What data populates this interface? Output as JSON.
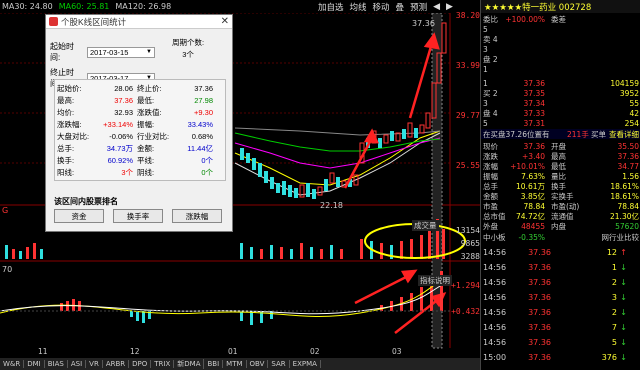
{
  "colors": {
    "up": "#ff3232",
    "down": "#2fe0e0",
    "accent": "#ffff00",
    "bg": "#000000"
  },
  "topbar": {
    "ma30": "MA30: 24.80",
    "ma60": "MA60: 25.81",
    "ma120": "MA120: 26.98",
    "tools": [
      "加自选",
      "均线",
      "移动",
      "叠",
      "预测"
    ]
  },
  "chart": {
    "price_labels": [
      "38.20",
      "33.99",
      "29.77",
      "25.55"
    ],
    "peak_label": "37.36",
    "low_label": "22.18",
    "volume_label": "成交量",
    "volume_ticks": [
      "13154",
      "9865",
      "3288"
    ],
    "macd_label": "指标说明",
    "macd_ticks": [
      "+1.294",
      "+0.432"
    ],
    "macd_prefix": "70",
    "date_ticks": [
      "11",
      "12",
      "01",
      "02",
      "03"
    ],
    "left_marker": "G"
  },
  "dialog": {
    "title": "个股K线区间统计",
    "start_label": "起始时间:",
    "start_value": "2017-03-15",
    "end_label": "终止时间:",
    "end_value": "2017-03-17",
    "period_label": "周期个数:",
    "period_value": "3个",
    "stats": [
      {
        "l1": "起始价:",
        "v1": "28.06",
        "c1": "",
        "l2": "终止价:",
        "v2": "37.36",
        "c2": ""
      },
      {
        "l1": "最高:",
        "v1": "37.36",
        "c1": "red",
        "l2": "最低:",
        "v2": "27.98",
        "c2": "grn"
      },
      {
        "l1": "均价:",
        "v1": "32.93",
        "c1": "",
        "l2": "涨跌值:",
        "v2": "+9.30",
        "c2": "red"
      },
      {
        "l1": "涨跌幅:",
        "v1": "+33.14%",
        "c1": "red",
        "l2": "振幅:",
        "v2": "33.43%",
        "c2": "blu"
      },
      {
        "l1": "大盘对比:",
        "v1": "-0.06%",
        "c1": "",
        "l2": "行业对比:",
        "v2": "0.68%",
        "c2": ""
      },
      {
        "l1": "总手:",
        "v1": "34.73万",
        "c1": "blu",
        "l2": "金额:",
        "v2": "11.44亿",
        "c2": "blu"
      },
      {
        "l1": "换手:",
        "v1": "60.92%",
        "c1": "blu",
        "l2": "平线:",
        "v2": "0个",
        "c2": "blu"
      },
      {
        "l1": "阳线:",
        "v1": "3个",
        "c1": "red",
        "l2": "阴线:",
        "v2": "0个",
        "c2": "grn"
      }
    ],
    "rank_title": "该区间内股票排名",
    "buttons": [
      "资金",
      "换手率",
      "涨跌幅"
    ]
  },
  "right": {
    "header": "★★★★★特一药业 002728",
    "rows": [
      {
        "a": "委比",
        "b": "+100.00%",
        "c": "委差",
        "d": "",
        "ac": "#ccc",
        "bc": "#f33",
        "cc": "#ccc",
        "dc": "#ff3"
      },
      {
        "a": "5",
        "b": "",
        "c": "",
        "d": "",
        "ac": "#ccc",
        "bc": "#ccc",
        "cc": "#ccc",
        "dc": "#ff3"
      },
      {
        "a": "卖 4",
        "b": "",
        "c": "",
        "d": "",
        "ac": "#ccc",
        "bc": "#ccc",
        "cc": "#ccc",
        "dc": "#ff3"
      },
      {
        "a": "3",
        "b": "",
        "c": "",
        "d": "",
        "ac": "#ccc",
        "bc": "#ccc",
        "cc": "#ccc",
        "dc": "#ff3"
      },
      {
        "a": "盘 2",
        "b": "",
        "c": "",
        "d": "",
        "ac": "#ccc",
        "bc": "#ccc",
        "cc": "#ccc",
        "dc": "#ff3"
      },
      {
        "a": "1",
        "b": "",
        "c": "",
        "d": "",
        "ac": "#ccc",
        "bc": "#ccc",
        "cc": "#ccc",
        "dc": "#ff3"
      },
      {
        "a": "1",
        "b": "37.36",
        "c": "",
        "d": "104159",
        "ac": "#ccc",
        "bc": "#f33",
        "cc": "#ccc",
        "dc": "#ff3"
      },
      {
        "a": "买 2",
        "b": "37.35",
        "c": "",
        "d": "3952",
        "ac": "#ccc",
        "bc": "#f33",
        "cc": "#ccc",
        "dc": "#ff3"
      },
      {
        "a": "3",
        "b": "37.34",
        "c": "",
        "d": "55",
        "ac": "#ccc",
        "bc": "#f33",
        "cc": "#ccc",
        "dc": "#ff3"
      },
      {
        "a": "盘 4",
        "b": "37.33",
        "c": "",
        "d": "42",
        "ac": "#ccc",
        "bc": "#f33",
        "cc": "#ccc",
        "dc": "#ff3"
      },
      {
        "a": "5",
        "b": "37.31",
        "c": "",
        "d": "254",
        "ac": "#ccc",
        "bc": "#f33",
        "cc": "#ccc",
        "dc": "#ff3"
      },
      {
        "a": "在买盘37.26位置有",
        "b": "211手",
        "c": "买单",
        "d": "查看详细",
        "ac": "#ccc",
        "bc": "#f33",
        "cc": "#ccc",
        "dc": "#ff3"
      },
      {
        "a": "现价",
        "b": "37.36",
        "c": "开盘",
        "d": "35.50",
        "ac": "#ccc",
        "bc": "#f33",
        "cc": "#ccc",
        "dc": "#f33"
      },
      {
        "a": "涨跌",
        "b": "+3.40",
        "c": "最高",
        "d": "37.36",
        "ac": "#ccc",
        "bc": "#f33",
        "cc": "#ccc",
        "dc": "#f33"
      },
      {
        "a": "涨幅",
        "b": "+10.01%",
        "c": "最低",
        "d": "34.77",
        "ac": "#ccc",
        "bc": "#f33",
        "cc": "#ccc",
        "dc": "#f33"
      },
      {
        "a": "振幅",
        "b": "7.63%",
        "c": "量比",
        "d": "1.56",
        "ac": "#ccc",
        "bc": "#ff3",
        "cc": "#ccc",
        "dc": "#ff3"
      },
      {
        "a": "总手",
        "b": "10.61万",
        "c": "换手",
        "d": "18.61%",
        "ac": "#ccc",
        "bc": "#ff3",
        "cc": "#ccc",
        "dc": "#ff3"
      },
      {
        "a": "金额",
        "b": "3.85亿",
        "c": "实换手",
        "d": "18.61%",
        "ac": "#ccc",
        "bc": "#ff3",
        "cc": "#ccc",
        "dc": "#ff3"
      },
      {
        "a": "市盈",
        "b": "78.84",
        "c": "市盈(动)",
        "d": "78.84",
        "ac": "#ccc",
        "bc": "#ff3",
        "cc": "#ccc",
        "dc": "#ff3"
      },
      {
        "a": "总市值",
        "b": "74.72亿",
        "c": "流通值",
        "d": "21.30亿",
        "ac": "#ccc",
        "bc": "#ff3",
        "cc": "#ccc",
        "dc": "#ff3"
      },
      {
        "a": "外盘",
        "b": "48455",
        "c": "内盘",
        "d": "57620",
        "ac": "#ccc",
        "bc": "#f33",
        "cc": "#ccc",
        "dc": "#3c3"
      },
      {
        "a": "中小板",
        "b": "-0.35%",
        "c": "",
        "d": "网行业比较",
        "ac": "#ccc",
        "bc": "#3c3",
        "cc": "#ccc",
        "dc": "#ccc"
      }
    ],
    "ticks": [
      {
        "t": "14:56",
        "p": "37.36",
        "v": "12",
        "dir": "↑"
      },
      {
        "t": "14:56",
        "p": "37.36",
        "v": "1",
        "dir": "↓"
      },
      {
        "t": "14:56",
        "p": "37.36",
        "v": "2",
        "dir": "↓"
      },
      {
        "t": "14:56",
        "p": "37.36",
        "v": "3",
        "dir": "↓"
      },
      {
        "t": "14:56",
        "p": "37.36",
        "v": "2",
        "dir": "↓"
      },
      {
        "t": "14:56",
        "p": "37.36",
        "v": "7",
        "dir": "↓"
      },
      {
        "t": "14:56",
        "p": "37.36",
        "v": "5",
        "dir": "↓"
      },
      {
        "t": "15:00",
        "p": "37.36",
        "v": "376",
        "dir": "↓"
      }
    ]
  },
  "tabs": [
    "W&R",
    "DMI",
    "BIAS",
    "ASI",
    "VR",
    "ARBR",
    "DPO",
    "TRIX",
    "新DMA",
    "BBI",
    "MTM",
    "OBV",
    "SAR",
    "EXPMA"
  ]
}
